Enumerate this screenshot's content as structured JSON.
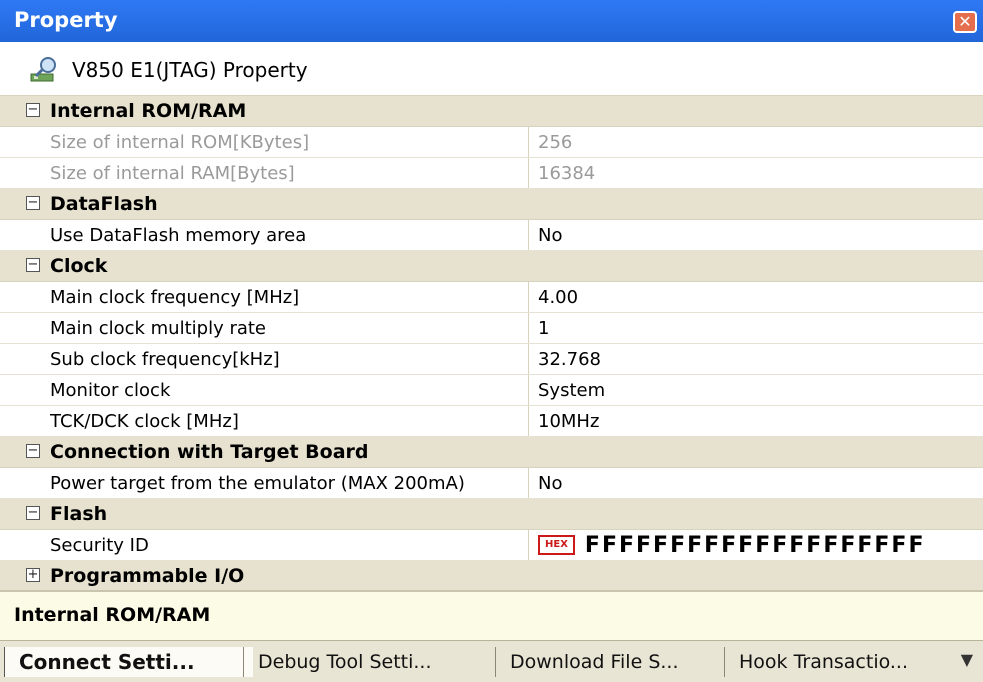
{
  "window": {
    "title": "Property"
  },
  "header": {
    "text": "V850 E1(JTAG) Property",
    "icon": "property-icon"
  },
  "grid": {
    "categories": [
      {
        "label": "Internal ROM/RAM",
        "expanded": true,
        "items": [
          {
            "name": "Size of internal ROM[KBytes]",
            "value": "256",
            "disabled": true
          },
          {
            "name": "Size of internal RAM[Bytes]",
            "value": "16384",
            "disabled": true
          }
        ]
      },
      {
        "label": "DataFlash",
        "expanded": true,
        "items": [
          {
            "name": "Use DataFlash memory area",
            "value": "No"
          }
        ]
      },
      {
        "label": "Clock",
        "expanded": true,
        "items": [
          {
            "name": "Main clock frequency [MHz]",
            "value": "4.00"
          },
          {
            "name": "Main clock multiply rate",
            "value": "1"
          },
          {
            "name": "Sub clock frequency[kHz]",
            "value": "32.768"
          },
          {
            "name": "Monitor clock",
            "value": "System"
          },
          {
            "name": "TCK/DCK clock [MHz]",
            "value": "10MHz"
          }
        ]
      },
      {
        "label": "Connection with Target Board",
        "expanded": true,
        "items": [
          {
            "name": "Power target from the emulator (MAX 200mA)",
            "value": "No"
          }
        ]
      },
      {
        "label": "Flash",
        "expanded": true,
        "items": [
          {
            "name": "Security ID",
            "badge": "HEX",
            "value": "FFFFFFFFFFFFFFFFFFFF"
          }
        ]
      },
      {
        "label": "Programmable I/O",
        "expanded": false,
        "items": []
      }
    ]
  },
  "description": {
    "text": "Internal ROM/RAM"
  },
  "tabs": [
    {
      "label": "Connect Setti...",
      "active": true
    },
    {
      "label": "Debug Tool Setti..."
    },
    {
      "label": "Download File S..."
    },
    {
      "label": "Hook Transactio..."
    }
  ],
  "colors": {
    "titlebar": "#2f79f5",
    "category_bg": "#e6e2cf",
    "desc_bg": "#fcfbe6",
    "hex_badge": "#cc1a1a"
  }
}
